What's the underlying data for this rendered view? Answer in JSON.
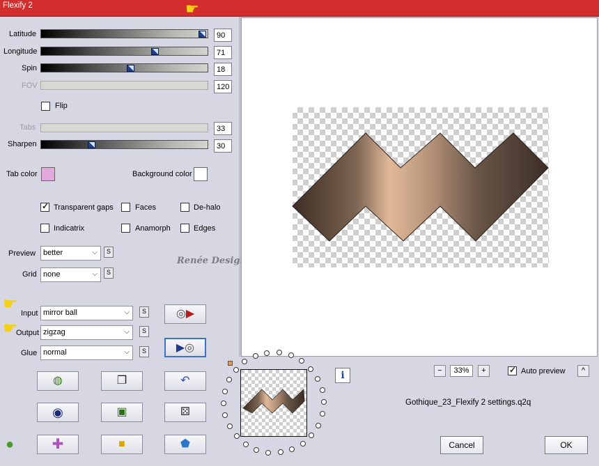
{
  "window": {
    "title": "Flexify 2"
  },
  "sliders": [
    {
      "label": "Latitude",
      "value": "90",
      "level": 0.97,
      "disabled": false
    },
    {
      "label": "Longitude",
      "value": "71",
      "level": 0.68,
      "disabled": false
    },
    {
      "label": "Spin",
      "value": "18",
      "level": 0.54,
      "disabled": false
    },
    {
      "label": "FOV",
      "value": "120",
      "level": null,
      "disabled": true
    },
    {
      "label": "Tabs",
      "value": "33",
      "level": null,
      "disabled": true
    },
    {
      "label": "Sharpen",
      "value": "30",
      "level": 0.3,
      "disabled": false
    }
  ],
  "flip": {
    "label": "Flip",
    "checked": false
  },
  "colors": {
    "tab_label": "Tab color",
    "tab_color": "#e3a9dd",
    "background_label": "Background color",
    "background_color": "#ffffff",
    "title_bar": "#d42d2d"
  },
  "options": [
    {
      "label": "Transparent gaps",
      "checked": true
    },
    {
      "label": "Faces",
      "checked": false
    },
    {
      "label": "De-halo",
      "checked": false
    },
    {
      "label": "Indicatrix",
      "checked": false
    },
    {
      "label": "Anamorph",
      "checked": false
    },
    {
      "label": "Edges",
      "checked": false
    }
  ],
  "preview": {
    "label": "Preview",
    "value": "better"
  },
  "grid": {
    "label": "Grid",
    "value": "none"
  },
  "input1": {
    "label": "Input",
    "value": "mirror ball"
  },
  "output": {
    "label": "Output",
    "value": "zigzag"
  },
  "glue": {
    "label": "Glue",
    "value": "normal"
  },
  "s_button": "S",
  "brand": "Renée Design",
  "zoom": {
    "minus": "−",
    "value": "33%",
    "plus": "+"
  },
  "auto_preview": {
    "label": "Auto preview",
    "checked": true,
    "collapse": "^"
  },
  "info": "i",
  "filename": "Gothique_23_Flexify 2 settings.q2q",
  "buttons": {
    "cancel": "Cancel",
    "ok": "OK"
  },
  "icons": {
    "input_to_output": "disc-arrow-icon",
    "output_to_input": "arrow-disc-icon",
    "randomize_globe": "globe-icon",
    "copy": "copy-icon",
    "undo": "undo-icon",
    "ring": "ring-icon",
    "square": "square-icon",
    "dice": "dice-icon",
    "cross": "cross-icon",
    "block": "block-icon",
    "gem": "pentagon-gem-icon",
    "apple": "apple-logo-icon",
    "hand": "pointing-hand-icon"
  }
}
